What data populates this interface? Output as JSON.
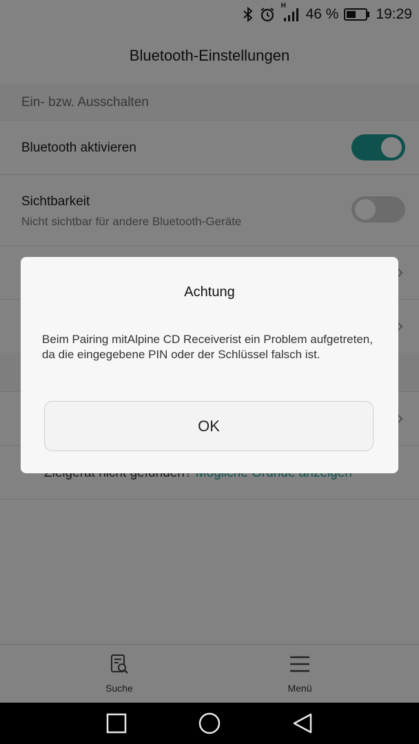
{
  "status_bar": {
    "network_label": "H",
    "battery_percent": "46 %",
    "time": "19:29",
    "icons": [
      "bluetooth-icon",
      "alarm-icon",
      "signal-icon",
      "battery-icon"
    ]
  },
  "app_bar": {
    "title": "Bluetooth-Einstellungen"
  },
  "sections": {
    "power_header": "Ein- bzw. Ausschalten",
    "enable_bluetooth": {
      "label": "Bluetooth aktivieren",
      "toggle_on": true
    },
    "visibility": {
      "label": "Sichtbarkeit",
      "sublabel": "Nicht sichtbar für andere Bluetooth-Geräte",
      "toggle_on": false
    }
  },
  "hint": {
    "prefix": "Zielgerät nicht gefunden? ",
    "link": "Mögliche Gründe anzeigen"
  },
  "bottom_bar": {
    "search_label": "Suche",
    "menu_label": "Menü"
  },
  "dialog": {
    "title": "Achtung",
    "message": "Beim Pairing mitAlpine CD Receiverist ein Problem aufgetreten, da die eingegebene PIN oder der Schlüssel falsch ist.",
    "ok_label": "OK"
  },
  "colors": {
    "accent": "#1e9b94",
    "toggle_off": "#cfcfcf",
    "scrim": "#000000"
  }
}
